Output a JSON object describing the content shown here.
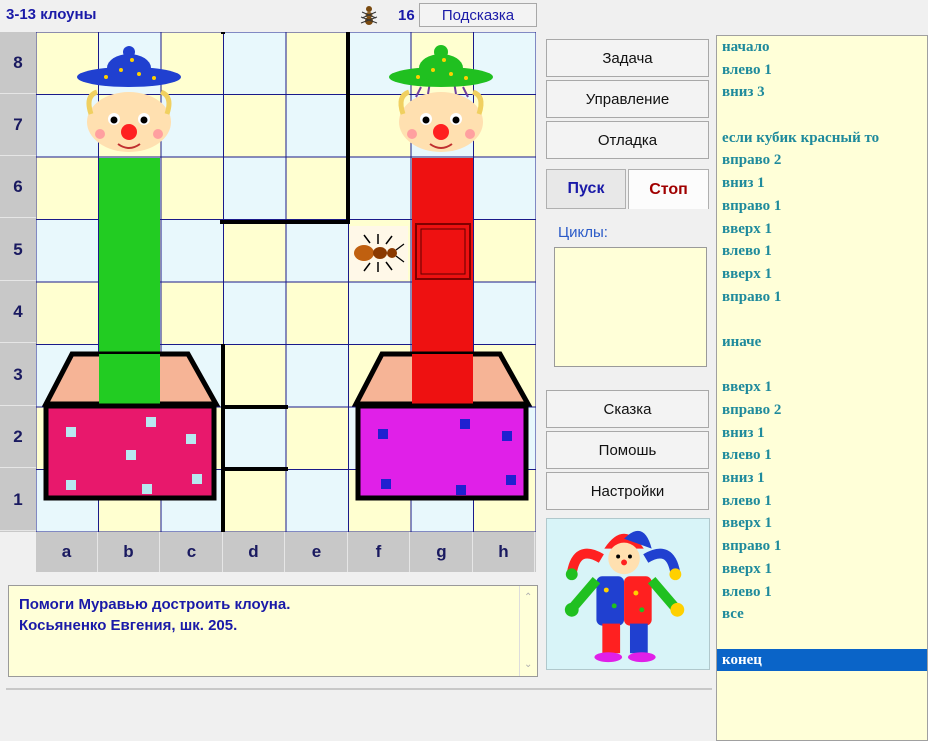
{
  "header": {
    "title": "3-13 клоуны",
    "step_count": "16",
    "hint_label": "Подсказка"
  },
  "grid": {
    "rows": [
      "8",
      "7",
      "6",
      "5",
      "4",
      "3",
      "2",
      "1"
    ],
    "cols": [
      "a",
      "b",
      "c",
      "d",
      "e",
      "f",
      "g",
      "h"
    ]
  },
  "menu": {
    "task": "Задача",
    "control": "Управление",
    "debug": "Отладка",
    "run": "Пуск",
    "stop": "Стоп",
    "loops_label": "Циклы:",
    "story": "Сказка",
    "help": "Помошь",
    "settings": "Настройки"
  },
  "message": {
    "line1": "Помоги Муравью достроить клоуна.",
    "line2": "Косьяненко Евгения, шк. 205."
  },
  "program": {
    "lines": [
      "начало",
      "влево 1",
      "вниз 3",
      "",
      "если кубик красный то",
      "вправо 2",
      "вниз 1",
      "вправо 1",
      "вверх 1",
      "влево 1",
      "вверх 1",
      "вправо 1",
      "",
      "иначе",
      "",
      "вверх 1",
      "вправо 2",
      "вниз 1",
      "влево 1",
      "вниз 1",
      "влево 1",
      "вверх 1",
      "вправо 1",
      "вверх 1",
      "влево 1",
      "все",
      "",
      "конец"
    ],
    "selected_line": "конец"
  },
  "colors": {
    "accent": "#1a1aa8",
    "stop_red": "#a00000",
    "green_block": "#22cc22",
    "red_block": "#ee1111",
    "pink_box": "#e8186c",
    "magenta_box": "#e020e8",
    "cell_yellow": "#ffffd0",
    "cell_blue": "#e8f8fc"
  }
}
